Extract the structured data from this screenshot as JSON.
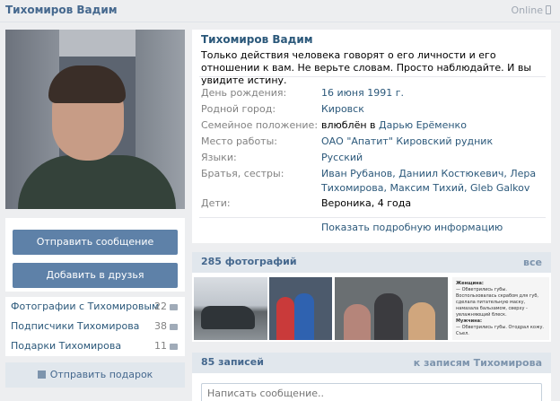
{
  "header": {
    "title": "Тихомиров Вадим",
    "online_label": "Online"
  },
  "profile": {
    "name": "Тихомиров Вадим",
    "status": "Только действия человека говорят о его личности и его отношении к вам. Не верьте словам. Просто наблюдайте. И вы увидите истину.",
    "fields": [
      {
        "label": "День рождения:",
        "value": "16 июня 1991 г."
      },
      {
        "label": "Родной город:",
        "value": "Кировск"
      },
      {
        "label": "Семейное положение:",
        "value_prefix": "влюблён в ",
        "value": "Дарью Ерёменко"
      },
      {
        "label": "Место работы:",
        "value": "ОАО \"Апатит\" Кировский рудник"
      },
      {
        "label": "Языки:",
        "value": "Русский"
      },
      {
        "label": "Братья, сестры:",
        "value": "Иван Рубанов, Даниил Костюкевич, Лера Тихомирова, Максим Тихий, Gleb Galkov"
      },
      {
        "label": "Дети:",
        "value": "Вероника, 4 года"
      }
    ],
    "more_link": "Показать подробную информацию"
  },
  "actions": {
    "send_message": "Отправить сообщение",
    "add_friend": "Добавить в друзья"
  },
  "side_links": [
    {
      "label": "Фотографии с Тихомировым",
      "count": "22",
      "icon": "camera-icon"
    },
    {
      "label": "Подписчики Тихомирова",
      "count": "38",
      "icon": "people-icon"
    },
    {
      "label": "Подарки Тихомирова",
      "count": "11",
      "icon": "gift-icon"
    }
  ],
  "gift_button": "Отправить подарок",
  "photos": {
    "title": "285 фотографий",
    "all_link": "все",
    "thumb_text": {
      "woman_label": "Женщина:",
      "woman_text": "— Обветрились губы. Воспользовалась скрабом для губ, сделала питательную маску, намазала бальзамом, сверху - увлажняющий блеск.",
      "man_label": "Мужчина:",
      "man_text": "— Обветрились губы. Отодрал кожу. Съел."
    }
  },
  "wall": {
    "title": "85 записей",
    "link": "к записям Тихомирова",
    "placeholder": "Написать сообщение.."
  },
  "colors": {
    "accent": "#5e81a8",
    "link": "#2b587a",
    "label": "#828282"
  }
}
